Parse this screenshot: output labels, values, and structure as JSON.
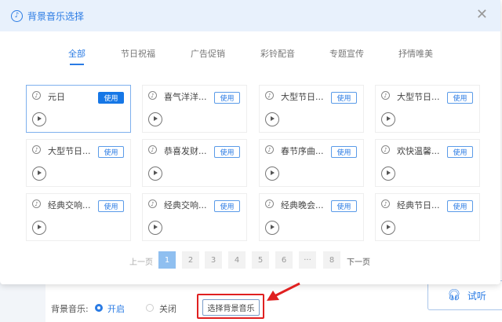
{
  "modal": {
    "title": "背景音乐选择",
    "close": "✕"
  },
  "tabs": [
    "全部",
    "节日祝福",
    "广告促销",
    "彩铃配音",
    "专题宣传",
    "抒情唯美"
  ],
  "active_tab": 0,
  "cards": [
    {
      "name": "元日",
      "selected": true
    },
    {
      "name": "喜气洋洋..."
    },
    {
      "name": "大型节日..."
    },
    {
      "name": "大型节日..."
    },
    {
      "name": "大型节日..."
    },
    {
      "name": "恭喜发财..."
    },
    {
      "name": "春节序曲..."
    },
    {
      "name": "欢快温馨..."
    },
    {
      "name": "经典交响..."
    },
    {
      "name": "经典交响..."
    },
    {
      "name": "经典晚会..."
    },
    {
      "name": "经典节日..."
    }
  ],
  "use_label": "使用",
  "pagination": {
    "prev": "上一页",
    "next": "下一页",
    "pages": [
      "1",
      "2",
      "3",
      "4",
      "5",
      "6",
      "···",
      "8"
    ],
    "current": "1"
  },
  "bottom": {
    "label": "背景音乐:",
    "on": "开启",
    "off": "关闭",
    "select_button": "选择背景音乐",
    "listen": "试听"
  },
  "colors": {
    "accent": "#2a7be4",
    "highlight": "#e02020"
  }
}
